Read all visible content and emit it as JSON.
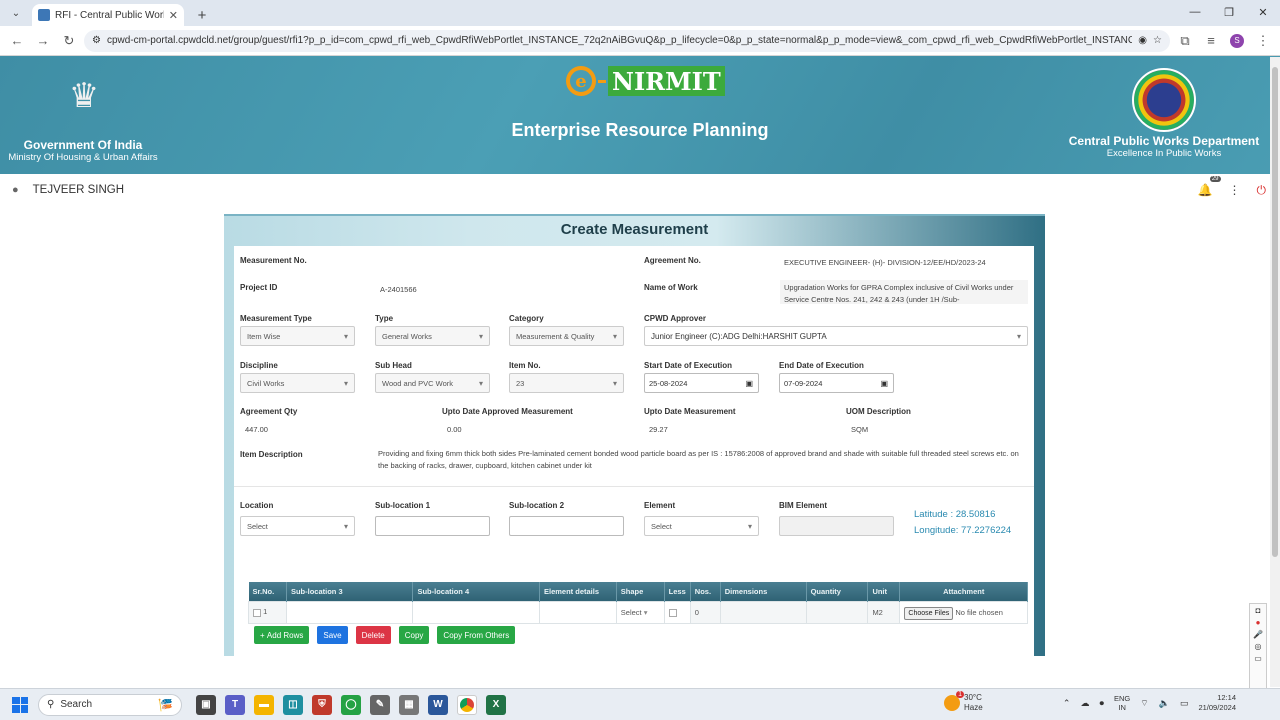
{
  "browser": {
    "tab_title": "RFI - Central Public Works Depa",
    "url": "cpwd-cm-portal.cpwdcld.net/group/guest/rfi1?p_p_id=com_cpwd_rfi_web_CpwdRfiWebPortlet_INSTANCE_72q2nAiBGvuQ&p_p_lifecycle=0&p_p_state=normal&p_p_mode=view&_com_cpwd_rfi_web_CpwdRfiWebPortlet_INSTANCE_72q2nAiBGv...",
    "profile_initial": "S"
  },
  "header": {
    "emblem_caption": "सत्यमेव जयते",
    "gov_title": "Government Of India",
    "ministry": "Ministry Of Housing & Urban Affairs",
    "logo_e": "e",
    "logo_text": "NIRMIT",
    "erp_title": "Enterprise Resource Planning",
    "cpwd_title": "Central Public Works Department",
    "cpwd_tagline": "Excellence In Public Works"
  },
  "user": {
    "name": "TEJVEER SINGH",
    "notifications": "29"
  },
  "form": {
    "title": "Create Measurement",
    "measurement_no_label": "Measurement No.",
    "agreement_no_label": "Agreement No.",
    "agreement_no_value": "EXECUTIVE ENGINEER- (H)- DIVISION-12/EE/HD/2023-24",
    "project_id_label": "Project ID",
    "project_id_value": "A-2401566",
    "name_of_work_label": "Name of Work",
    "name_of_work_value": "Upgradation Works for GPRA Complex inclusive of Civil Works under Service Centre Nos. 241, 242  & 243 (under 1H /Sub-",
    "measurement_type_label": "Measurement Type",
    "measurement_type_value": "Item Wise",
    "type_label": "Type",
    "type_value": "General Works",
    "category_label": "Category",
    "category_value": "Measurement & Quality",
    "approver_label": "CPWD Approver",
    "approver_value": "Junior Engineer (C):ADG Delhi:HARSHIT GUPTA",
    "discipline_label": "Discipline",
    "discipline_value": "Civil Works",
    "subhead_label": "Sub Head",
    "subhead_value": "Wood and PVC Work",
    "itemno_label": "Item No.",
    "itemno_value": "23",
    "start_label": "Start Date of Execution",
    "start_value": "25-08-2024",
    "end_label": "End Date of Execution",
    "end_value": "07-09-2024",
    "agreement_qty_label": "Agreement Qty",
    "agreement_qty_value": "447.00",
    "upto_approved_label": "Upto Date Approved Measurement",
    "upto_approved_value": "0.00",
    "upto_label": "Upto Date Measurement",
    "upto_value": "29.27",
    "uom_label": "UOM Description",
    "uom_value": "SQM",
    "item_desc_label": "Item Description",
    "item_desc_value": "Providing and fixing 6mm thick both sides Pre-laminated cement bonded wood particle board as per IS : 15786:2008 of approved brand and shade with suitable full threaded steel screws etc. on the backing of racks, drawer, cupboard, kitchen cabinet under kit",
    "location_label": "Location",
    "location_value": "Select",
    "subloc1_label": "Sub-location 1",
    "subloc2_label": "Sub-location 2",
    "element_label": "Element",
    "element_value": "Select",
    "bim_label": "BIM Element",
    "latitude": "Latitude : 28.50816",
    "longitude": "Longitude: 77.2276224"
  },
  "table": {
    "headers": [
      "Sr.No.",
      "Sub-location 3",
      "Sub-location 4",
      "Element details",
      "Shape",
      "Less",
      "Nos.",
      "Dimensions",
      "Quantity",
      "Unit",
      "Attachment"
    ],
    "row": {
      "sr": "1",
      "shape": "Select",
      "nos": "0",
      "unit": "M2",
      "choose_files": "Choose Files",
      "no_file": "No file chosen"
    }
  },
  "buttons": {
    "add_rows": "Add Rows",
    "save": "Save",
    "delete": "Delete",
    "copy": "Copy",
    "copy_from_others": "Copy From Others"
  },
  "taskbar": {
    "search": "Search",
    "weather_temp": "30°C",
    "weather_desc": "Haze",
    "weather_badge": "1",
    "lang1": "ENG",
    "lang2": "IN",
    "time": "12:14",
    "date": "21/09/2024"
  }
}
